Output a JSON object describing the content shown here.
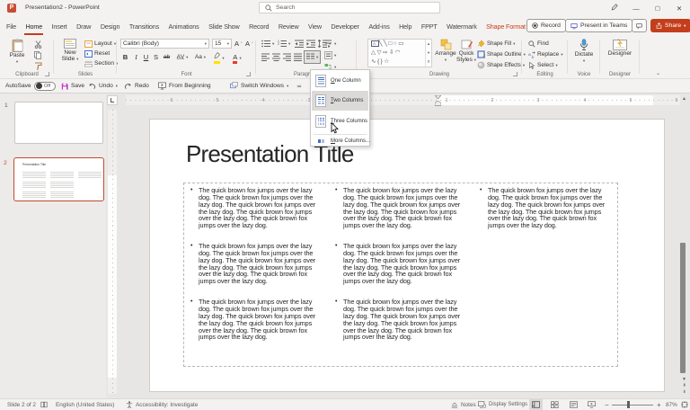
{
  "titlebar": {
    "title": "Presentation2 - PowerPoint",
    "search_placeholder": "Search"
  },
  "tabs": [
    "File",
    "Home",
    "Insert",
    "Draw",
    "Design",
    "Transitions",
    "Animations",
    "Slide Show",
    "Record",
    "Review",
    "View",
    "Developer",
    "Add-ins",
    "Help",
    "FPPT",
    "Watermark",
    "Shape Format"
  ],
  "actions": {
    "record": "Record",
    "teams": "Present in Teams",
    "share": "Share"
  },
  "ribbon": {
    "clipboard": {
      "paste": "Paste",
      "label": "Clipboard"
    },
    "slides": {
      "new1": "New",
      "new2": "Slide",
      "layout": "Layout",
      "reset": "Reset",
      "section": "Section",
      "label": "Slides"
    },
    "font": {
      "name": "Calibri (Body)",
      "size": "15",
      "label": "Font"
    },
    "paragraph": {
      "label": "Paragraph"
    },
    "drawing": {
      "arrange": "Arrange",
      "quick1": "Quick",
      "quick2": "Styles",
      "fill": "Shape Fill",
      "outline": "Shape Outline",
      "effects": "Shape Effects",
      "label": "Drawing"
    },
    "editing": {
      "find": "Find",
      "replace": "Replace",
      "select": "Select",
      "label": "Editing"
    },
    "voice": {
      "dictate": "Dictate",
      "label": "Voice"
    },
    "designer": {
      "designer": "Designer",
      "label": "Designer"
    }
  },
  "qat": {
    "autosave": "AutoSave",
    "state": "Off",
    "save": "Save",
    "undo": "Undo",
    "redo": "Redo",
    "from_beginning": "From Beginning",
    "switch_windows": "Switch Windows"
  },
  "columns_menu": {
    "one": "One Column",
    "two": "Two Columns",
    "three": "Three Columns",
    "more": "More Columns..."
  },
  "ruler": {
    "l0": "6",
    "l1": "5",
    "l2": "4",
    "l3": "3",
    "r0": "1",
    "r1": "2",
    "r2": "3",
    "r3": "4",
    "r4": "5",
    "r5": "6"
  },
  "panel": {
    "slide1_num": "1",
    "slide2_num": "2",
    "thumb_title": "Presentation Title"
  },
  "slide": {
    "title": "Presentation Title",
    "body": "The quick brown fox jumps over the lazy dog. The quick brown fox jumps over the lazy dog. The quick brown fox jumps over the lazy dog. The quick brown fox jumps over the lazy dog. The quick brown fox jumps over the lazy dog."
  },
  "status": {
    "slide": "Slide 2 of 2",
    "lang": "English (United States)",
    "accessibility": "Accessibility: Investigate",
    "notes": "Notes",
    "display": "Display Settings",
    "zoom": "87%"
  }
}
